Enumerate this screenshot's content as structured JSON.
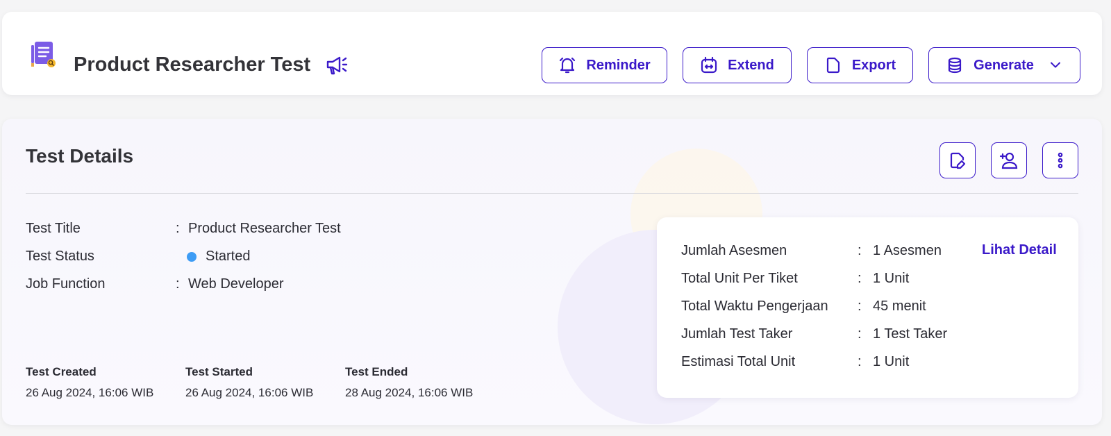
{
  "header": {
    "title": "Product Researcher Test",
    "buttons": {
      "reminder": "Reminder",
      "extend": "Extend",
      "export": "Export",
      "generate": "Generate"
    }
  },
  "details": {
    "section_title": "Test Details",
    "fields": [
      {
        "label": "Test Title",
        "colon": ":",
        "value": "Product Researcher Test"
      },
      {
        "label": "Test Status",
        "value": "Started"
      },
      {
        "label": "Job Function",
        "colon": ":",
        "value": "Web Developer"
      }
    ],
    "dates": [
      {
        "label": "Test Created",
        "value": "26 Aug 2024, 16:06 WIB"
      },
      {
        "label": "Test Started",
        "value": "26 Aug 2024, 16:06 WIB"
      },
      {
        "label": "Test Ended",
        "value": "28 Aug 2024, 16:06 WIB"
      }
    ]
  },
  "summary": {
    "rows": [
      {
        "label": "Jumlah Asesmen",
        "colon": ":",
        "value": "1 Asesmen"
      },
      {
        "label": "Total Unit Per Tiket",
        "colon": ":",
        "value": "1 Unit"
      },
      {
        "label": "Total Waktu Pengerjaan",
        "colon": ":",
        "value": "45 menit"
      },
      {
        "label": "Jumlah Test Taker",
        "colon": ":",
        "value": "1 Test Taker"
      },
      {
        "label": "Estimasi Total Unit",
        "colon": ":",
        "value": "1 Unit"
      }
    ],
    "link": "Lihat Detail"
  },
  "colors": {
    "accent": "#3a19c9",
    "status_started": "#3d9cf5",
    "title_icon": "#7b5ce6"
  },
  "icons": [
    "document-icon",
    "megaphone-icon",
    "bell-icon",
    "calendar-icon",
    "file-icon",
    "database-icon",
    "chevron-down-icon",
    "edit-document-icon",
    "add-person-icon",
    "more-vertical-icon"
  ]
}
